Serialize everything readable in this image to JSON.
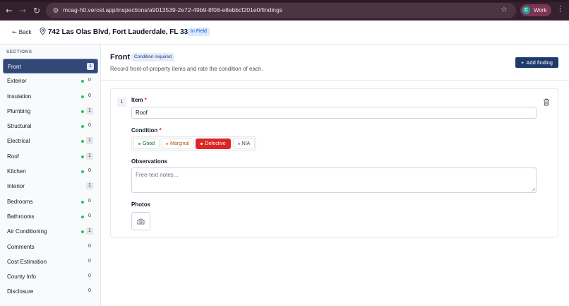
{
  "browser": {
    "url": "mcag-h0.vercel.app/inspections/a9013539-2e72-49b9-8f08-e8ebbcf201e0/findings",
    "profile_initial": "C",
    "profile_name": "Work",
    "icons": [
      "back-arrow-icon",
      "forward-arrow-icon",
      "reload-icon",
      "site-settings-icon",
      "star-icon",
      "kebab-menu-icon"
    ]
  },
  "header": {
    "back_label": "Back",
    "address": "742 Las Olas Blvd, Fort Lauderdale, FL 33301",
    "status": "In Field"
  },
  "sidebar": {
    "title": "SECTIONS",
    "items": [
      {
        "label": "Front",
        "count": "1",
        "dot": false,
        "active": true
      },
      {
        "label": "Exterior",
        "count": "0",
        "dot": true
      },
      {
        "label": "Insulation",
        "count": "0",
        "dot": true
      },
      {
        "label": "Plumbing",
        "count": "1",
        "dot": true
      },
      {
        "label": "Structural",
        "count": "0",
        "dot": true
      },
      {
        "label": "Electrical",
        "count": "1",
        "dot": true
      },
      {
        "label": "Roof",
        "count": "1",
        "dot": true
      },
      {
        "label": "Kitchen",
        "count": "0",
        "dot": true
      },
      {
        "label": "Interior",
        "count": "1",
        "dot": false
      },
      {
        "label": "Bedrooms",
        "count": "0",
        "dot": true
      },
      {
        "label": "Bathrooms",
        "count": "0",
        "dot": true
      },
      {
        "label": "Air Conditioning",
        "count": "1",
        "dot": true
      },
      {
        "label": "Comments",
        "count": "0",
        "dot": false
      },
      {
        "label": "Cost Estimation",
        "count": "0",
        "dot": false
      },
      {
        "label": "County Info",
        "count": "0",
        "dot": false
      },
      {
        "label": "Disclosure",
        "count": "0",
        "dot": false
      }
    ]
  },
  "main": {
    "title": "Front",
    "badge": "Condition required",
    "subtitle": "Record front-of-property items and rate the condition of each.",
    "add_button": "Add finding",
    "finding": {
      "number": "1",
      "item_label": "Item",
      "item_value": "Roof",
      "condition_label": "Condition",
      "conditions": [
        "Good",
        "Marginal",
        "Defective",
        "N/A"
      ],
      "selected_condition": "Defective",
      "observations_label": "Observations",
      "observations_placeholder": "Free-text notes...",
      "photos_label": "Photos"
    }
  },
  "colors": {
    "accent": "#1e3a6b",
    "active_section": "#324977",
    "defective": "#dc2626",
    "good_dot": "#22c55e",
    "marginal": "#f59e0b"
  }
}
